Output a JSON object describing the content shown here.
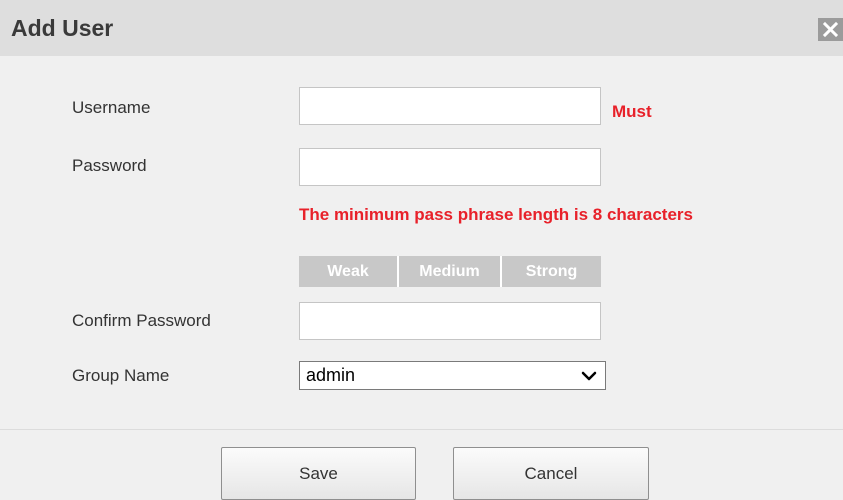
{
  "dialog": {
    "title": "Add User",
    "close_icon": "close-icon"
  },
  "form": {
    "username": {
      "label": "Username",
      "value": "",
      "required_text": "Must"
    },
    "password": {
      "label": "Password",
      "value": "",
      "hint": "The minimum pass phrase length is 8 characters"
    },
    "strength": {
      "weak": "Weak",
      "medium": "Medium",
      "strong": "Strong"
    },
    "confirm_password": {
      "label": "Confirm Password",
      "value": ""
    },
    "group_name": {
      "label": "Group Name",
      "selected": "admin",
      "arrow_icon": "chevron-down-icon"
    }
  },
  "footer": {
    "save_label": "Save",
    "cancel_label": "Cancel"
  },
  "colors": {
    "title_bar": "#dedede",
    "panel": "#f0f0f0",
    "error_red": "#e8212a",
    "strength_inactive": "#c8c8c8"
  }
}
